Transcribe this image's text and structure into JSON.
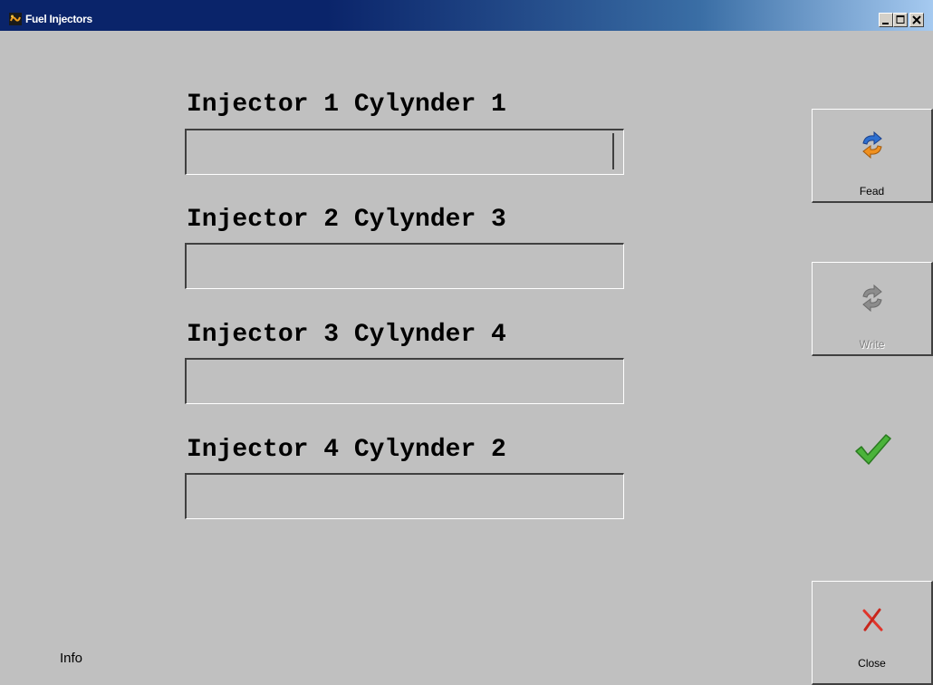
{
  "window": {
    "title": "Fuel Injectors",
    "controls": [
      "minimize",
      "maximize",
      "close"
    ]
  },
  "fields": [
    {
      "label": "Injector 1 Cylynder 1",
      "value": "",
      "focused": true
    },
    {
      "label": "Injector 2 Cylynder 3",
      "value": ""
    },
    {
      "label": "Injector 3 Cylynder 4",
      "value": ""
    },
    {
      "label": "Injector 4 Cylynder 2",
      "value": ""
    }
  ],
  "buttons": {
    "read": {
      "label": "Fead",
      "icon": "refresh-arrows-icon",
      "enabled": true
    },
    "write": {
      "label": "Write",
      "icon": "refresh-arrows-icon",
      "enabled": false
    },
    "close": {
      "label": "Close",
      "icon": "red-x-icon",
      "enabled": true
    }
  },
  "status": {
    "icon": "green-checkmark-icon"
  },
  "footer": {
    "info_label": "Info"
  },
  "colors": {
    "titlebar_start": "#0a246a",
    "titlebar_end": "#a6caf0",
    "background": "#c0c0c0",
    "check_green": "#3a9a2a",
    "close_red": "#e0352b"
  }
}
